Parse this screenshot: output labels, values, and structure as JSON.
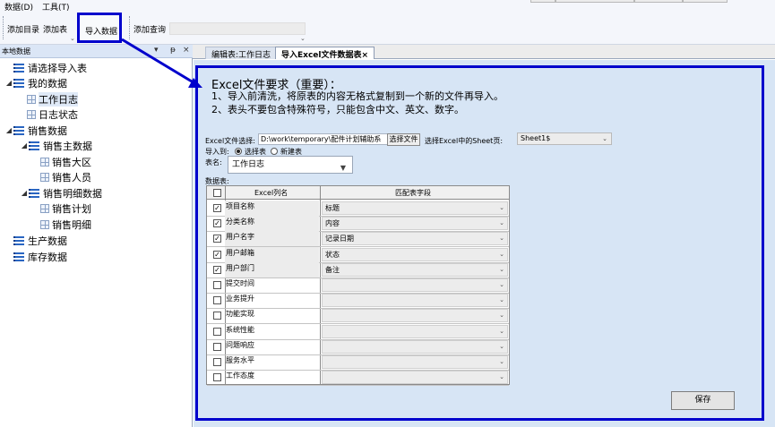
{
  "menu": [
    "数据(D)",
    "工具(T)"
  ],
  "toolbar": {
    "add_dir": "添加目录",
    "add_table": "添加表",
    "import_data": "导入数据",
    "add_query": "添加查询"
  },
  "left_panel": {
    "title": "本地数据",
    "controls": [
      "▾",
      "ᵽ",
      "×"
    ],
    "tree": [
      {
        "label": "请选择导入表",
        "icon": "list-icon",
        "level": 0,
        "arrow": ""
      },
      {
        "label": "我的数据",
        "icon": "list-icon",
        "level": 0,
        "arrow": "◢"
      },
      {
        "label": "工作日志",
        "icon": "table-icon",
        "level": 1,
        "arrow": ""
      },
      {
        "label": "日志状态",
        "icon": "table-icon",
        "level": 1,
        "arrow": ""
      },
      {
        "label": "销售数据",
        "icon": "list-icon",
        "level": 0,
        "arrow": "◢"
      },
      {
        "label": "销售主数据",
        "icon": "list-icon",
        "level": 1,
        "arrow": "◢"
      },
      {
        "label": "销售大区",
        "icon": "table-icon",
        "level": 2,
        "arrow": ""
      },
      {
        "label": "销售人员",
        "icon": "table-icon",
        "level": 2,
        "arrow": ""
      },
      {
        "label": "销售明细数据",
        "icon": "list-icon",
        "level": 1,
        "arrow": "◢"
      },
      {
        "label": "销售计划",
        "icon": "table-icon",
        "level": 2,
        "arrow": ""
      },
      {
        "label": "销售明细",
        "icon": "table-icon",
        "level": 2,
        "arrow": ""
      },
      {
        "label": "生产数据",
        "icon": "list-icon",
        "level": 0,
        "arrow": ""
      },
      {
        "label": "库存数据",
        "icon": "list-icon",
        "level": 0,
        "arrow": ""
      }
    ]
  },
  "tabs": [
    {
      "label": "编辑表:工作日志",
      "active": false
    },
    {
      "label": "导入Excel文件数据表",
      "active": true,
      "close": "×"
    }
  ],
  "requirements": {
    "title": "Excel文件要求（重要）：",
    "line1": "1、导入前清洗，将原表的内容无格式复制到一个新的文件再导入。",
    "line2": "2、表头不要包含特殊符号，只能包含中文、英文、数字。"
  },
  "form": {
    "file_label": "Excel文件选择:",
    "file_value": "D:\\work\\temporary\\配件计划辅助系",
    "file_button": "选择文件",
    "sheet_label": "选择Excel中的Sheet页:",
    "sheet_value": "Sheet1$",
    "import_to_label": "导入到:",
    "radio_existing": "选择表",
    "radio_new": "新建表",
    "table_label": "表名:",
    "table_value": "工作日志",
    "grid_label": "数据表:"
  },
  "grid": {
    "col_excel": "Excel列名",
    "col_match": "匹配表字段",
    "rows": [
      {
        "checked": true,
        "name": "项目名称",
        "field": "标题"
      },
      {
        "checked": true,
        "name": "分类名称",
        "field": "内容"
      },
      {
        "checked": true,
        "name": "用户名字",
        "field": "记录日期"
      },
      {
        "checked": true,
        "name": "用户邮箱",
        "field": "状态"
      },
      {
        "checked": true,
        "name": "用户部门",
        "field": "备注"
      },
      {
        "checked": false,
        "name": "提交时间",
        "field": ""
      },
      {
        "checked": false,
        "name": "业务提升",
        "field": ""
      },
      {
        "checked": false,
        "name": "功能实现",
        "field": ""
      },
      {
        "checked": false,
        "name": "系统性能",
        "field": ""
      },
      {
        "checked": false,
        "name": "问题响应",
        "field": ""
      },
      {
        "checked": false,
        "name": "服务水平",
        "field": ""
      },
      {
        "checked": false,
        "name": "工作态度",
        "field": ""
      }
    ]
  },
  "save_button": "保存",
  "colors": {
    "annotation": "#0000cc",
    "panel_bg": "#d7e5f5",
    "icon_blue": "#2a66c2"
  }
}
